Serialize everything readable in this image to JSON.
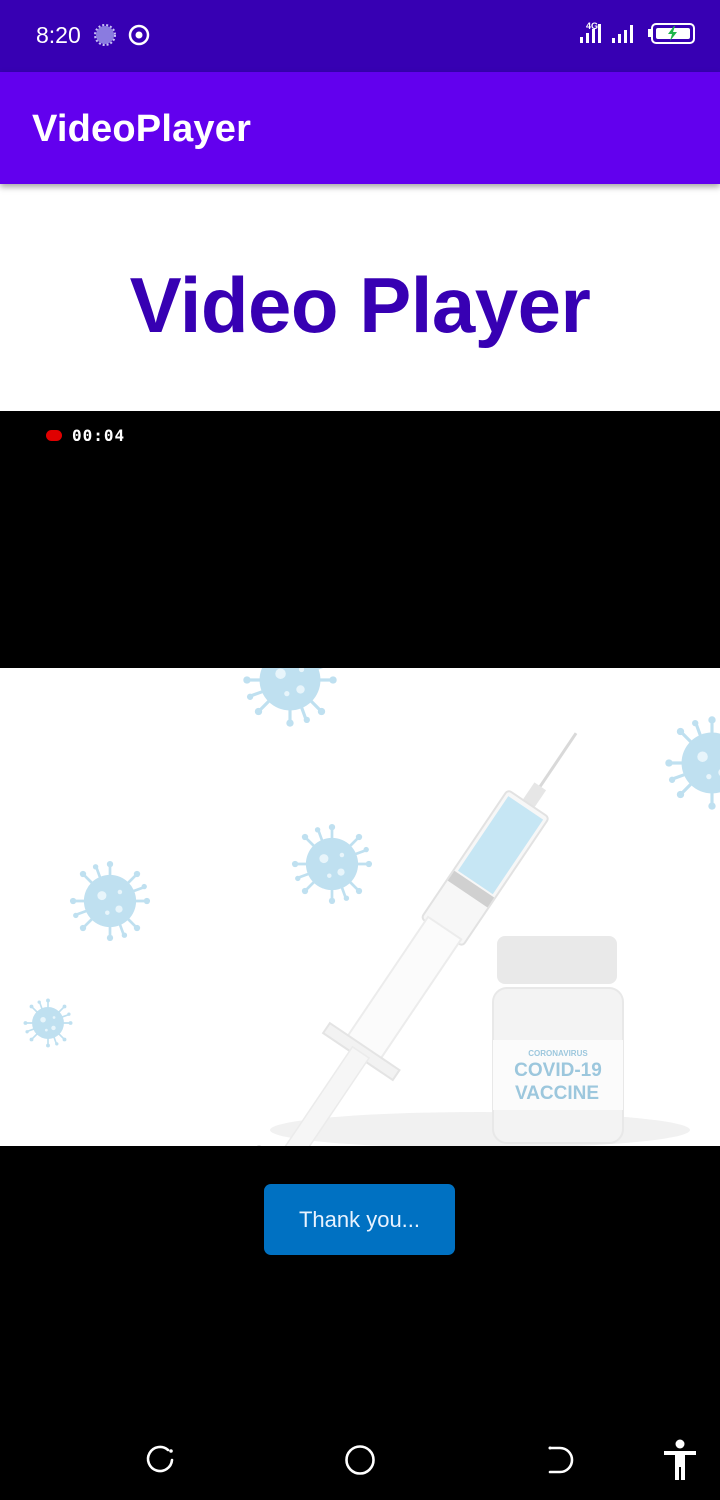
{
  "status_bar": {
    "time": "8:20",
    "network_label": "4G",
    "icons": [
      "loading-spinner-icon",
      "target-icon",
      "signal-4g-icon",
      "signal-icon",
      "battery-charging-icon"
    ]
  },
  "app_bar": {
    "title": "VideoPlayer"
  },
  "content": {
    "heading": "Video Player"
  },
  "video": {
    "recording_time": "00:04",
    "frame": {
      "bottle_label_small": "CORONAVIRUS",
      "bottle_label_line1": "COVID-19",
      "bottle_label_line2": "VACCINE"
    },
    "overlay_button": "Thank you..."
  },
  "nav_bar": {
    "icons": [
      "recents-icon",
      "home-icon",
      "back-icon",
      "accessibility-icon"
    ]
  },
  "colors": {
    "status_bar": "#3700b3",
    "app_bar": "#6200ee",
    "heading": "#3700b3",
    "button": "#0071c2",
    "recording_dot": "#e00000",
    "virus": "#bfe0f0"
  }
}
